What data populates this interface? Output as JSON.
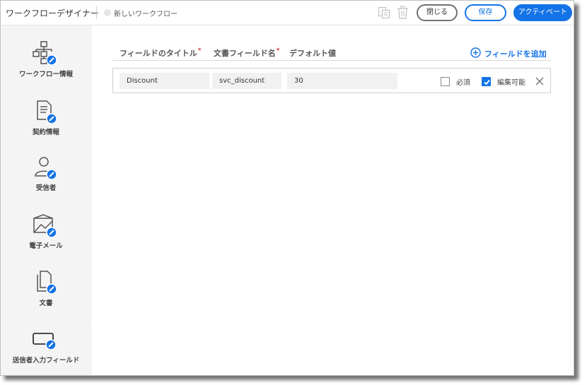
{
  "header": {
    "app_title": "ワークフローデザイナー",
    "workflow_name": "新しいワークフロー",
    "close_label": "閉じる",
    "save_label": "保存",
    "activate_label": "アクティベート"
  },
  "sidebar": {
    "items": [
      {
        "label": "ワークフロー情報",
        "icon": "workflow-icon"
      },
      {
        "label": "契約情報",
        "icon": "document-icon"
      },
      {
        "label": "受信者",
        "icon": "user-icon"
      },
      {
        "label": "電子メール",
        "icon": "email-icon"
      },
      {
        "label": "文書",
        "icon": "files-icon"
      },
      {
        "label": "送信者入力フィールド",
        "icon": "field-icon"
      }
    ],
    "active_index": 5
  },
  "main": {
    "columns": {
      "title": "フィールドのタイトル",
      "name": "文書フィールド名",
      "default": "デフォルト値"
    },
    "required_mark": "*",
    "add_field_label": "フィールドを追加",
    "rows": [
      {
        "title": "Discount",
        "name": "svc_discount",
        "default": "30",
        "required_label": "必須",
        "required": false,
        "editable_label": "編集可能",
        "editable": true
      }
    ]
  },
  "colors": {
    "accent": "#1473e6",
    "required_star": "#d7373f",
    "sidebar_bg": "#f4f4f4"
  }
}
